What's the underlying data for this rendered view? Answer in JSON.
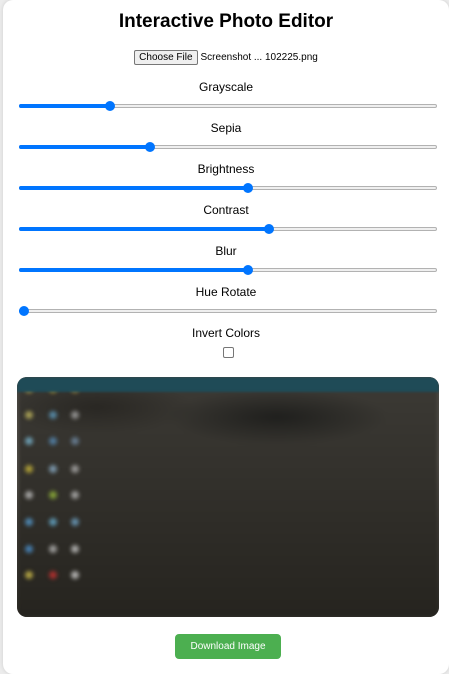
{
  "app": {
    "title": "Interactive Photo Editor"
  },
  "file_input": {
    "button_label": "Choose File",
    "file_name": "Screenshot ... 102225.png"
  },
  "controls": [
    {
      "label": "Grayscale",
      "value": 0.21
    },
    {
      "label": "Sepia",
      "value": 0.31
    },
    {
      "label": "Brightness",
      "value": 0.55
    },
    {
      "label": "Contrast",
      "value": 0.6
    },
    {
      "label": "Blur",
      "value": 0.55
    },
    {
      "label": "Hue Rotate",
      "value": 0.0
    }
  ],
  "invert": {
    "label": "Invert Colors",
    "checked": false
  },
  "download": {
    "label": "Download Image"
  },
  "colors": {
    "accent": "#0075ff",
    "download_button": "#4caf50"
  }
}
